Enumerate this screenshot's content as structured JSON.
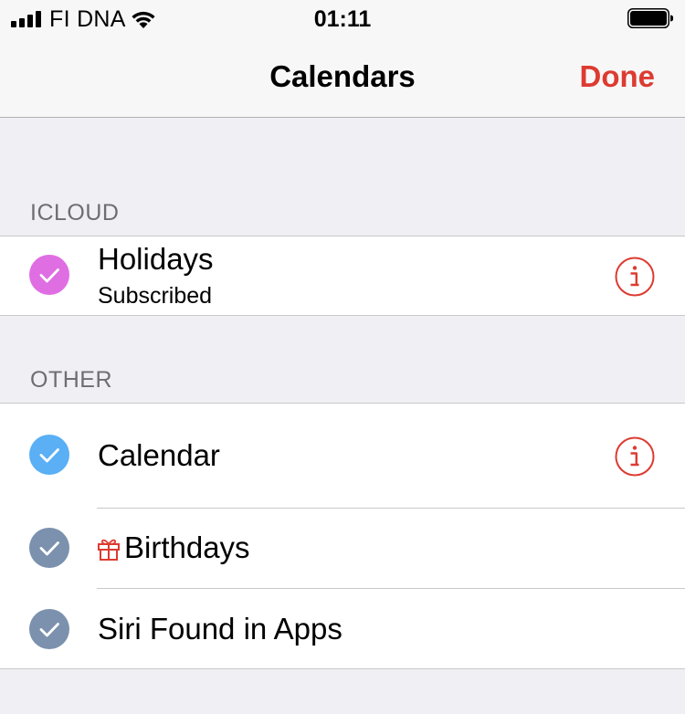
{
  "status_bar": {
    "carrier": "FI DNA",
    "time": "01:11"
  },
  "nav": {
    "title": "Calendars",
    "done_label": "Done"
  },
  "colors": {
    "accent": "#dd3b31",
    "holidays": "#df6ee3",
    "calendar": "#5aaff5",
    "birthdays": "#7b91ad",
    "siri": "#7b91ad"
  },
  "icloud": {
    "header": "ICLOUD",
    "items": [
      {
        "title": "Holidays",
        "subtitle": "Subscribed",
        "checked": true,
        "has_info": true,
        "icon": "info-icon"
      }
    ]
  },
  "other": {
    "header": "OTHER",
    "items": [
      {
        "title": "Calendar",
        "checked": true,
        "has_info": true,
        "icon": "info-icon"
      },
      {
        "title": "Birthdays",
        "checked": true,
        "has_info": false,
        "icon": "gift-icon"
      },
      {
        "title": "Siri Found in Apps",
        "checked": true,
        "has_info": false
      }
    ]
  }
}
